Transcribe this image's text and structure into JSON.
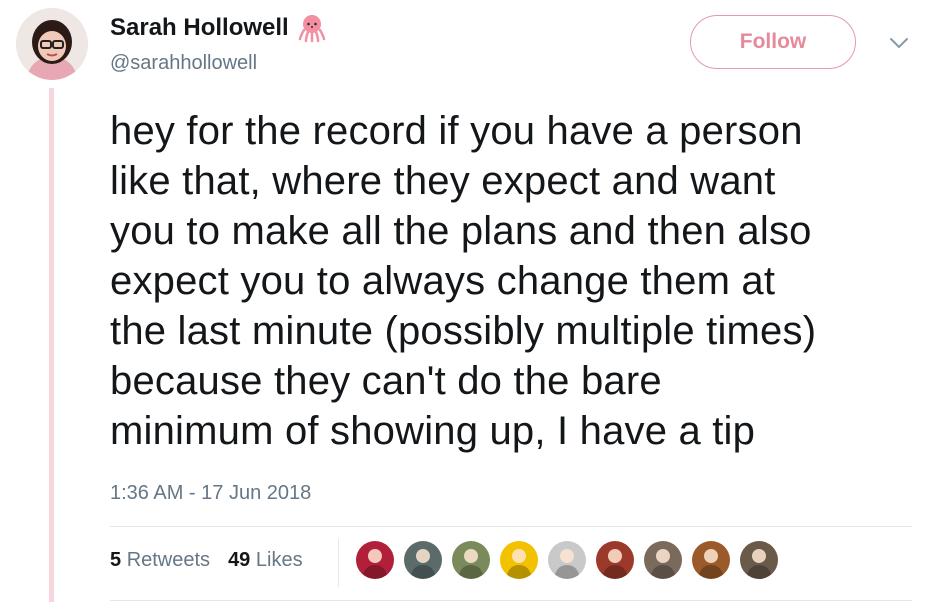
{
  "user": {
    "name": "Sarah Hollowell",
    "handle": "@sarahhollowell",
    "badge_icon": "octopus-emoji-icon"
  },
  "follow_button": {
    "label": "Follow"
  },
  "menu_icon": "chevron-down-icon",
  "tweet": {
    "lines": [
      "hey for the record if you have a person",
      "like that, where they expect and want",
      "you to make all the plans and then also",
      "expect you to always change them at",
      "the last minute (possibly multiple times)",
      "because they can't do the bare",
      "minimum of showing up, I have a tip"
    ],
    "timestamp": "1:36 AM - 17 Jun 2018"
  },
  "stats": {
    "retweets_count": "5",
    "retweets_label": "Retweets",
    "likes_count": "49",
    "likes_label": "Likes"
  },
  "likers": [
    {
      "name": "liker-avatar-1",
      "color": "#b21f3a"
    },
    {
      "name": "liker-avatar-2",
      "color": "#5a6b6a"
    },
    {
      "name": "liker-avatar-3",
      "color": "#7a8a5a"
    },
    {
      "name": "liker-avatar-4",
      "color": "#f2c200"
    },
    {
      "name": "liker-avatar-5",
      "color": "#c9c9c9"
    },
    {
      "name": "liker-avatar-6",
      "color": "#9b3a2a"
    },
    {
      "name": "liker-avatar-7",
      "color": "#7a6a5c"
    },
    {
      "name": "liker-avatar-8",
      "color": "#9a5a2a"
    },
    {
      "name": "liker-avatar-9",
      "color": "#6a5a4a"
    }
  ],
  "colors": {
    "accent": "#e58a9a",
    "thread_line": "#f6d6dc",
    "muted_text": "#657786",
    "text": "#14171a"
  }
}
